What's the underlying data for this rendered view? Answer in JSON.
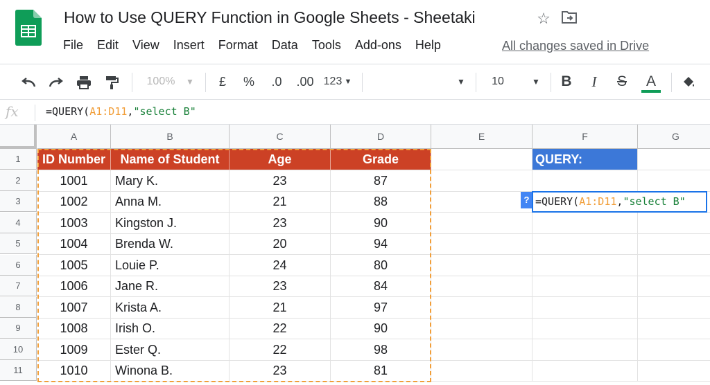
{
  "doc": {
    "title": "How to Use QUERY Function in Google Sheets - Sheetaki",
    "saved_status": "All changes saved in Drive"
  },
  "menu": [
    "File",
    "Edit",
    "View",
    "Insert",
    "Format",
    "Data",
    "Tools",
    "Add-ons",
    "Help"
  ],
  "toolbar": {
    "zoom": "100%",
    "currency": "£",
    "percent": "%",
    "decrease_decimal": ".0",
    "increase_decimal": ".00",
    "more_formats": "123",
    "font_size": "10",
    "bold": "B",
    "italic": "I",
    "strikethrough": "S",
    "text_color": "A",
    "text_color_value": "#0f9d58"
  },
  "formula_bar": {
    "fx": "fx",
    "formula_parts": [
      "=QUERY(",
      "A1:D11",
      ",",
      "\"select B\""
    ]
  },
  "grid": {
    "columns": [
      "A",
      "B",
      "C",
      "D",
      "E",
      "F",
      "G"
    ],
    "rows": [
      "1",
      "2",
      "3",
      "4",
      "5",
      "6",
      "7",
      "8",
      "9",
      "10",
      "11"
    ],
    "headers": [
      "ID Number",
      "Name of Student",
      "Age",
      "Grade"
    ],
    "data": [
      [
        "1001",
        "Mary K.",
        "23",
        "87"
      ],
      [
        "1002",
        "Anna M.",
        "21",
        "88"
      ],
      [
        "1003",
        "Kingston J.",
        "23",
        "90"
      ],
      [
        "1004",
        "Brenda W.",
        "20",
        "94"
      ],
      [
        "1005",
        "Louie P.",
        "24",
        "80"
      ],
      [
        "1006",
        "Jane R.",
        "23",
        "84"
      ],
      [
        "1007",
        "Krista A.",
        "21",
        "97"
      ],
      [
        "1008",
        "Irish O.",
        "22",
        "90"
      ],
      [
        "1009",
        "Ester Q.",
        "22",
        "98"
      ],
      [
        "1010",
        "Winona B.",
        "23",
        "81"
      ]
    ],
    "query_label": "QUERY:",
    "help_badge": "?",
    "header_color": "#cc4125",
    "query_color": "#3c78d8"
  }
}
